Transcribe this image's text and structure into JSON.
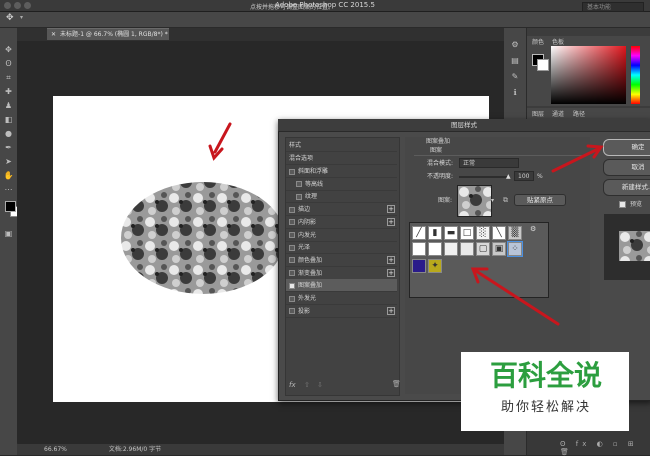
{
  "app": {
    "window_title": "Adobe Photoshop CC 2015.5",
    "options_hint": "点按并拖移可调整图案的位置。",
    "workspace": "基本功能",
    "document_tab": "未标题-1 @ 66.7% (椭圆 1, RGB/8*) *",
    "zoom": "66.67%",
    "doc_info": "文档:2.96M/0 字节"
  },
  "right_panel": {
    "color_tabs": [
      "颜色",
      "色板"
    ],
    "layer_tabs": [
      "图层",
      "通道",
      "路径"
    ]
  },
  "dialog": {
    "title": "图层样式",
    "style_list": [
      {
        "label": "样式",
        "type": "header"
      },
      {
        "label": "混合选项",
        "type": "header"
      },
      {
        "label": "斜面和浮雕",
        "checked": false,
        "plus": false
      },
      {
        "label": "等高线",
        "checked": false,
        "plus": false,
        "indent": true
      },
      {
        "label": "纹理",
        "checked": false,
        "plus": false,
        "indent": true
      },
      {
        "label": "描边",
        "checked": false,
        "plus": true
      },
      {
        "label": "内阴影",
        "checked": false,
        "plus": true
      },
      {
        "label": "内发光",
        "checked": false,
        "plus": false
      },
      {
        "label": "光泽",
        "checked": false,
        "plus": false
      },
      {
        "label": "颜色叠加",
        "checked": false,
        "plus": true
      },
      {
        "label": "渐变叠加",
        "checked": false,
        "plus": true
      },
      {
        "label": "图案叠加",
        "checked": true,
        "plus": false,
        "selected": true
      },
      {
        "label": "外发光",
        "checked": false,
        "plus": false
      },
      {
        "label": "投影",
        "checked": false,
        "plus": true
      }
    ],
    "section_title": "图案叠加",
    "section_subtitle": "图案",
    "blend_label": "混合模式:",
    "blend_value": "正常",
    "opacity_label": "不透明度:",
    "opacity_value": "100",
    "opacity_unit": "%",
    "pattern_label": "图案:",
    "snap_button": "贴紧原点",
    "buttons": {
      "ok": "确定",
      "cancel": "取消",
      "new_style": "新建样式...",
      "preview": "预览"
    },
    "fx_label": "fx"
  },
  "watermark": {
    "title": "百科全说",
    "subtitle": "助你轻松解决"
  },
  "colors": {
    "accent_arrow": "#c8161d",
    "watermark_green": "#2c9e3f"
  }
}
